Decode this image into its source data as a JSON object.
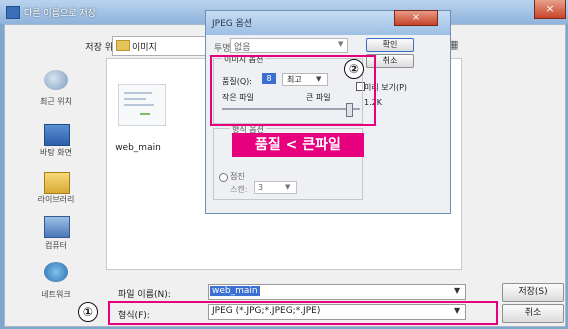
{
  "main_dialog": {
    "title": "다른 이름으로 저장",
    "close_label": "×",
    "save_in_label": "저장 위치(I):",
    "save_in_value": "이미지",
    "sidebar": [
      {
        "label": "최근 위치",
        "icon": "recent-places-icon"
      },
      {
        "label": "바탕 화면",
        "icon": "desktop-icon"
      },
      {
        "label": "라이브러리",
        "icon": "library-icon"
      },
      {
        "label": "컴퓨터",
        "icon": "computer-icon"
      },
      {
        "label": "네트워크",
        "icon": "network-icon"
      }
    ],
    "files": [
      {
        "name": "web_main"
      }
    ],
    "filename_label": "파일 이름(N):",
    "filename_value": "web_main",
    "filetype_label": "형식(F):",
    "filetype_value": "JPEG (*.JPG;*.JPEG;*.JPE)",
    "save_button": "저장(S)",
    "cancel_button": "취소"
  },
  "jpeg_options": {
    "title": "JPEG 옵션",
    "close_label": "×",
    "format_label": "투명도",
    "format_value": "없음",
    "ok_button": "확인",
    "cancel_button": "취소",
    "preview_label": "미리 보기(P)",
    "size_label": "1.2K",
    "image_options_legend": "이미지 옵션",
    "quality_label": "품질(Q):",
    "quality_value": "8",
    "quality_level": "최고",
    "small_file_label": "작은 파일",
    "large_file_label": "큰 파일",
    "quality_fraction": 0.95,
    "format_options_legend": "형식 옵션",
    "progressive_label": "점진",
    "scans_label": "스캔:",
    "scans_value": "3"
  },
  "annotations": {
    "callout": "품질 < 큰파일",
    "marker_1": "①",
    "marker_2": "②",
    "highlight_color": "#e6007e"
  }
}
